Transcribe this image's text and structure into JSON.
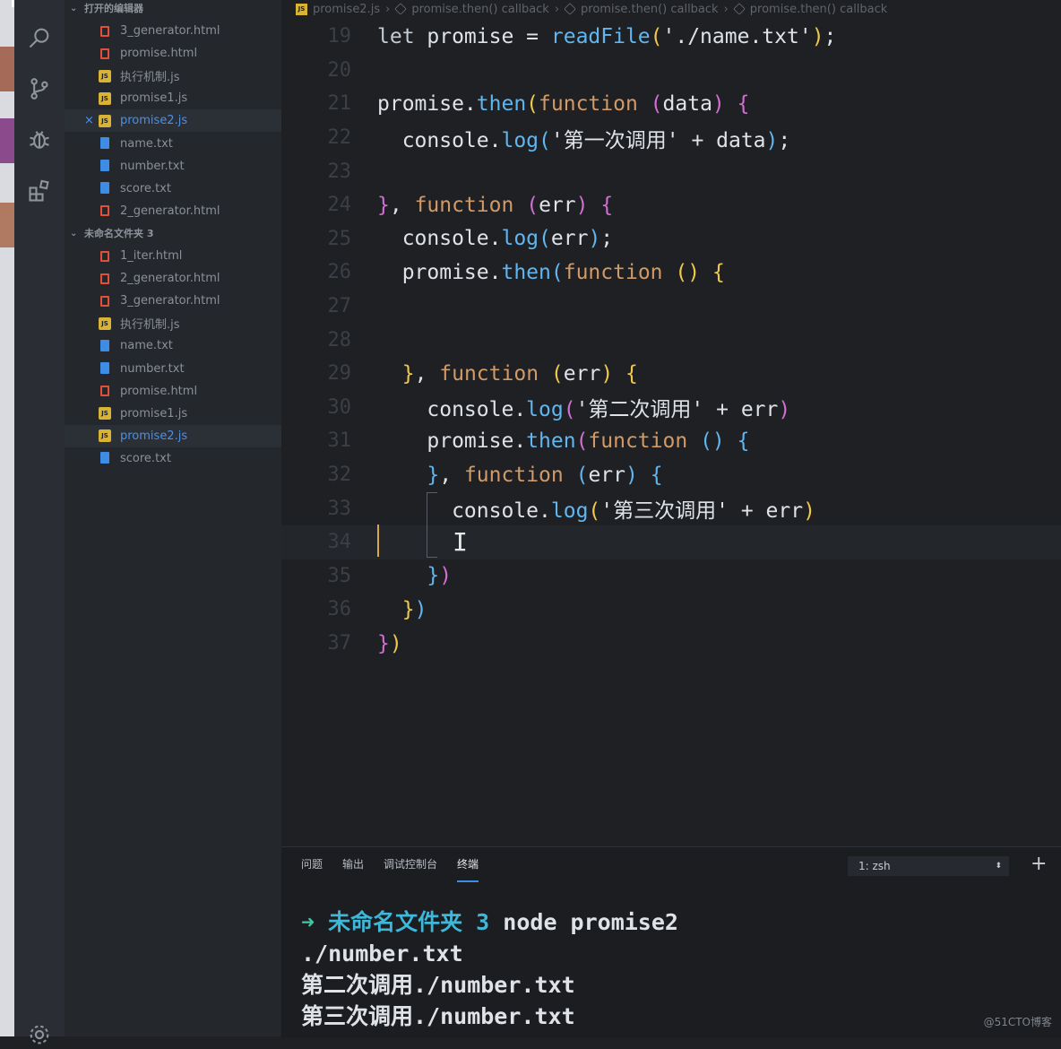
{
  "sidebar": {
    "section_open": "打开的编辑器",
    "open_files": [
      {
        "name": "3_generator.html",
        "type": "html"
      },
      {
        "name": "promise.html",
        "type": "html"
      },
      {
        "name": "执行机制.js",
        "type": "js"
      },
      {
        "name": "promise1.js",
        "type": "js"
      },
      {
        "name": "promise2.js",
        "type": "js",
        "active": true
      },
      {
        "name": "name.txt",
        "type": "txt"
      },
      {
        "name": "number.txt",
        "type": "txt"
      },
      {
        "name": "score.txt",
        "type": "txt"
      },
      {
        "name": "2_generator.html",
        "type": "html"
      }
    ],
    "section_folder": "未命名文件夹 3",
    "folder_files": [
      {
        "name": "1_iter.html",
        "type": "html"
      },
      {
        "name": "2_generator.html",
        "type": "html"
      },
      {
        "name": "3_generator.html",
        "type": "html"
      },
      {
        "name": "执行机制.js",
        "type": "js"
      },
      {
        "name": "name.txt",
        "type": "txt"
      },
      {
        "name": "number.txt",
        "type": "txt"
      },
      {
        "name": "promise.html",
        "type": "html"
      },
      {
        "name": "promise1.js",
        "type": "js"
      },
      {
        "name": "promise2.js",
        "type": "js",
        "active": true
      },
      {
        "name": "score.txt",
        "type": "txt"
      }
    ],
    "close_glyph": "×",
    "js_badge": "JS"
  },
  "breadcrumb": {
    "file": "promise2.js",
    "items": [
      "promise.then() callback",
      "promise.then() callback",
      "promise.then() callback"
    ]
  },
  "editor": {
    "current_line": 34,
    "lines": [
      {
        "n": "19",
        "code": "let promise = readFile('./name.txt');"
      },
      {
        "n": "20",
        "code": ""
      },
      {
        "n": "21",
        "code": "promise.then(function (data) {"
      },
      {
        "n": "22",
        "code": "  console.log('第一次调用' + data);"
      },
      {
        "n": "23",
        "code": ""
      },
      {
        "n": "24",
        "code": "}, function (err) {"
      },
      {
        "n": "25",
        "code": "  console.log(err);"
      },
      {
        "n": "26",
        "code": "  promise.then(function () {"
      },
      {
        "n": "27",
        "code": ""
      },
      {
        "n": "28",
        "code": ""
      },
      {
        "n": "29",
        "code": "  }, function (err) {"
      },
      {
        "n": "30",
        "code": "    console.log('第二次调用' + err)"
      },
      {
        "n": "31",
        "code": "    promise.then(function () {"
      },
      {
        "n": "32",
        "code": "    }, function (err) {"
      },
      {
        "n": "33",
        "code": "      console.log('第三次调用' + err)"
      },
      {
        "n": "34",
        "code": ""
      },
      {
        "n": "35",
        "code": "    })"
      },
      {
        "n": "36",
        "code": "  })"
      },
      {
        "n": "37",
        "code": "})"
      }
    ]
  },
  "panel": {
    "tabs": [
      "问题",
      "输出",
      "调试控制台",
      "终端"
    ],
    "active_tab": "终端",
    "terminal_select": "1: zsh",
    "terminal_select_arrows": "⬍",
    "new_terminal": "+",
    "terminal_lines": [
      {
        "arrow": "➜",
        "folder": "未命名文件夹 3",
        "cmd": "node promise2"
      },
      {
        "text": "./number.txt"
      },
      {
        "text": "第二次调用./number.txt"
      },
      {
        "text": "第三次调用./number.txt"
      }
    ]
  },
  "watermark": "@51CTO博客",
  "colors": {
    "accent": "#3d8de6",
    "brace_yellow": "#f0c94c",
    "brace_pink": "#d16fd3",
    "function_blue": "#61b6ef",
    "keyword_orange": "#d19a66",
    "terminal_green": "#3fc8a5",
    "terminal_cyan": "#3fb7d8"
  },
  "icons": {
    "activity": [
      "search-icon",
      "source-control-icon",
      "debug-icon",
      "extensions-icon",
      "settings-gear-icon"
    ]
  }
}
